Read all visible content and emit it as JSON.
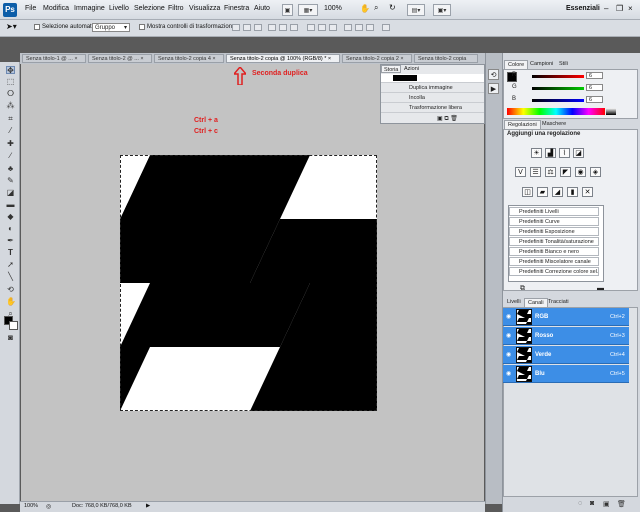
{
  "menubar": {
    "logo": "Ps",
    "items": [
      "File",
      "Modifica",
      "Immagine",
      "Livello",
      "Selezione",
      "Filtro",
      "Visualizza",
      "Finestra",
      "Aiuto"
    ],
    "zoom": "100%",
    "workspace": "Essenziali"
  },
  "options": {
    "auto_select_label": "Selezione automatica:",
    "group_value": "Gruppo",
    "show_transform_label": "Mostra controlli di trasformazione"
  },
  "tabs": [
    {
      "label": "Senza titolo-1 @ ..."
    },
    {
      "label": "Senza titolo-2 @ ..."
    },
    {
      "label": "Senza titolo-2 copia 4"
    },
    {
      "label": "Senza titolo-2 copia @ 100% (RGB/8) *"
    },
    {
      "label": "Senza titolo-2 copia 2"
    },
    {
      "label": "Senza titolo-2 copia"
    }
  ],
  "annotations": {
    "seconda": "Seconda duplica",
    "ctrl_a": "Ctrl + a",
    "ctrl_c": "Ctrl + c"
  },
  "history": {
    "tab1": "Storia",
    "tab2": "Azioni",
    "rows": [
      "Duplica immagine",
      "Incolla",
      "Trasformazione libera"
    ]
  },
  "color_panel": {
    "tabs": [
      "Colore",
      "Campioni",
      "Stili"
    ],
    "r_label": "R",
    "g_label": "G",
    "b_label": "B",
    "r": "6",
    "g": "6",
    "b": "6"
  },
  "adjustments": {
    "tabs": [
      "Regolazioni",
      "Maschere"
    ],
    "title": "Aggiungi una regolazione",
    "presets": [
      "Predefiniti Livelli",
      "Predefiniti Curve",
      "Predefiniti Esposizione",
      "Predefiniti Tonalità/saturazione",
      "Predefiniti Bianco e nero",
      "Predefiniti Miscelatore canale",
      "Predefiniti Correzione colore sel..."
    ]
  },
  "channels": {
    "tabs": [
      "Livelli",
      "Canali",
      "Tracciati"
    ],
    "rows": [
      {
        "name": "RGB",
        "key": "Ctrl+2"
      },
      {
        "name": "Rosso",
        "key": "Ctrl+3"
      },
      {
        "name": "Verde",
        "key": "Ctrl+4"
      },
      {
        "name": "Blu",
        "key": "Ctrl+5"
      }
    ]
  },
  "status": {
    "zoom": "100%",
    "doc": "Doc: 768,0 KB/768,0 KB"
  },
  "colors": {
    "accent": "#3d8ee6",
    "annotation": "#e02020"
  }
}
